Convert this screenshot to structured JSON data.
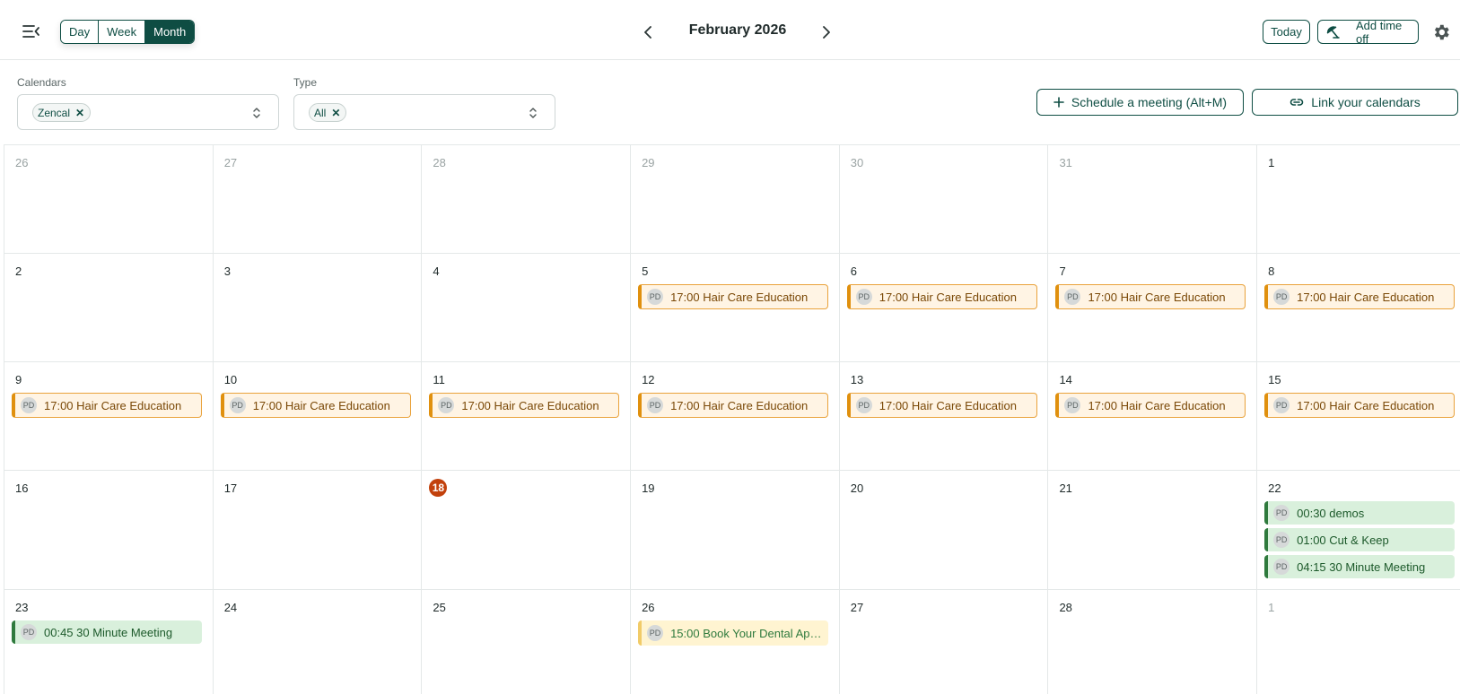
{
  "header": {
    "views": [
      "Day",
      "Week",
      "Month"
    ],
    "active_view": "Month",
    "title": "February 2026",
    "today_label": "Today",
    "time_off_label": "Add time off"
  },
  "filters": {
    "calendars_label": "Calendars",
    "calendars_value": "Zencal",
    "type_label": "Type",
    "type_value": "All",
    "schedule_label": "Schedule a meeting (Alt+M)",
    "link_label": "Link your calendars"
  },
  "colors": {
    "brand": "#0e4d43",
    "today": "#c2410c",
    "event_orange": "#e0900e",
    "event_green": "#2f7a3d",
    "event_yellow": "#f1cb68"
  },
  "weeks": [
    {
      "days": [
        {
          "num": "26",
          "muted": true,
          "events": []
        },
        {
          "num": "27",
          "muted": true,
          "events": []
        },
        {
          "num": "28",
          "muted": true,
          "events": []
        },
        {
          "num": "29",
          "muted": true,
          "events": []
        },
        {
          "num": "30",
          "muted": true,
          "events": []
        },
        {
          "num": "31",
          "muted": true,
          "events": []
        },
        {
          "num": "1",
          "events": []
        }
      ]
    },
    {
      "days": [
        {
          "num": "2",
          "events": []
        },
        {
          "num": "3",
          "events": []
        },
        {
          "num": "4",
          "events": []
        },
        {
          "num": "5",
          "events": [
            {
              "avatar": "PD",
              "text": "17:00 Hair Care Education",
              "color": "orange"
            }
          ]
        },
        {
          "num": "6",
          "events": [
            {
              "avatar": "PD",
              "text": "17:00 Hair Care Education",
              "color": "orange"
            }
          ]
        },
        {
          "num": "7",
          "events": [
            {
              "avatar": "PD",
              "text": "17:00 Hair Care Education",
              "color": "orange"
            }
          ]
        },
        {
          "num": "8",
          "events": [
            {
              "avatar": "PD",
              "text": "17:00 Hair Care Education",
              "color": "orange"
            }
          ]
        }
      ]
    },
    {
      "days": [
        {
          "num": "9",
          "events": [
            {
              "avatar": "PD",
              "text": "17:00 Hair Care Education",
              "color": "orange"
            }
          ]
        },
        {
          "num": "10",
          "events": [
            {
              "avatar": "PD",
              "text": "17:00 Hair Care Education",
              "color": "orange"
            }
          ]
        },
        {
          "num": "11",
          "events": [
            {
              "avatar": "PD",
              "text": "17:00 Hair Care Education",
              "color": "orange"
            }
          ]
        },
        {
          "num": "12",
          "events": [
            {
              "avatar": "PD",
              "text": "17:00 Hair Care Education",
              "color": "orange"
            }
          ]
        },
        {
          "num": "13",
          "events": [
            {
              "avatar": "PD",
              "text": "17:00 Hair Care Education",
              "color": "orange"
            }
          ]
        },
        {
          "num": "14",
          "events": [
            {
              "avatar": "PD",
              "text": "17:00 Hair Care Education",
              "color": "orange"
            }
          ]
        },
        {
          "num": "15",
          "events": [
            {
              "avatar": "PD",
              "text": "17:00 Hair Care Education",
              "color": "orange"
            }
          ]
        }
      ]
    },
    {
      "days": [
        {
          "num": "16",
          "events": []
        },
        {
          "num": "17",
          "events": []
        },
        {
          "num": "18",
          "today": true,
          "events": []
        },
        {
          "num": "19",
          "events": []
        },
        {
          "num": "20",
          "events": []
        },
        {
          "num": "21",
          "events": []
        },
        {
          "num": "22",
          "events": [
            {
              "avatar": "PD",
              "text": "00:30 demos",
              "color": "green"
            },
            {
              "avatar": "PD",
              "text": "01:00 Cut & Keep",
              "color": "green"
            },
            {
              "avatar": "PD",
              "text": "04:15 30 Minute Meeting",
              "color": "green"
            }
          ]
        }
      ]
    },
    {
      "days": [
        {
          "num": "23",
          "events": [
            {
              "avatar": "PD",
              "text": "00:45 30 Minute Meeting",
              "color": "green"
            }
          ]
        },
        {
          "num": "24",
          "events": []
        },
        {
          "num": "25",
          "events": []
        },
        {
          "num": "26",
          "events": [
            {
              "avatar": "PD",
              "text": "15:00 Book Your Dental App...",
              "color": "yellow"
            }
          ]
        },
        {
          "num": "27",
          "events": []
        },
        {
          "num": "28",
          "events": []
        },
        {
          "num": "1",
          "muted": true,
          "events": []
        }
      ]
    }
  ]
}
